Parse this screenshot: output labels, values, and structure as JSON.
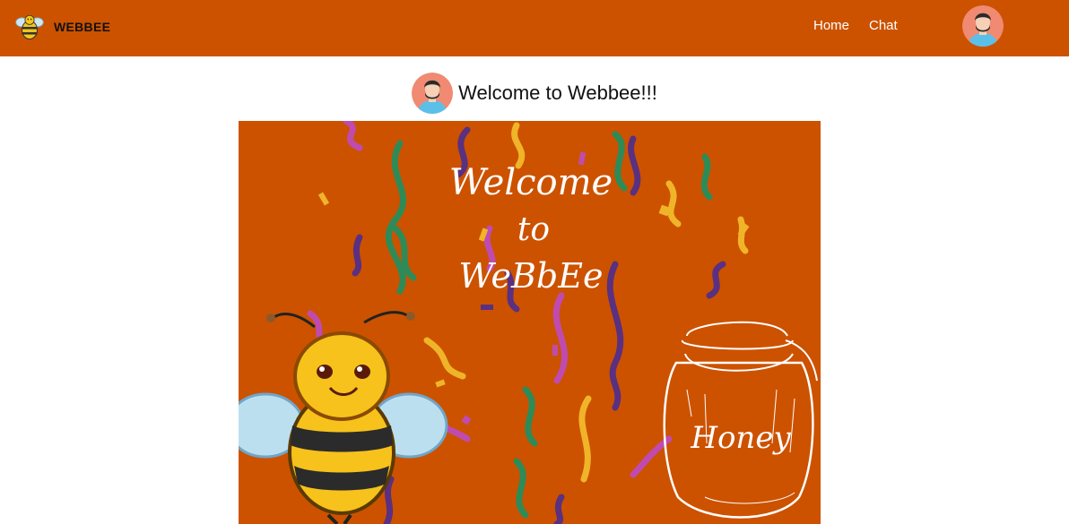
{
  "colors": {
    "brand": "#cc5200",
    "hero_bg": "#cc5200"
  },
  "header": {
    "brand_name": "WEBBEE",
    "logo_icon": "bee-icon",
    "nav": [
      {
        "label": "Home"
      },
      {
        "label": "Chat"
      }
    ],
    "avatar_icon": "user-avatar-icon"
  },
  "welcome": {
    "title": "Welcome to Webbee!!!",
    "avatar_icon": "user-avatar-icon"
  },
  "hero": {
    "line1": "Welcome",
    "line2": "to",
    "line3": "WeBbEe",
    "jar_label": "Honey"
  }
}
